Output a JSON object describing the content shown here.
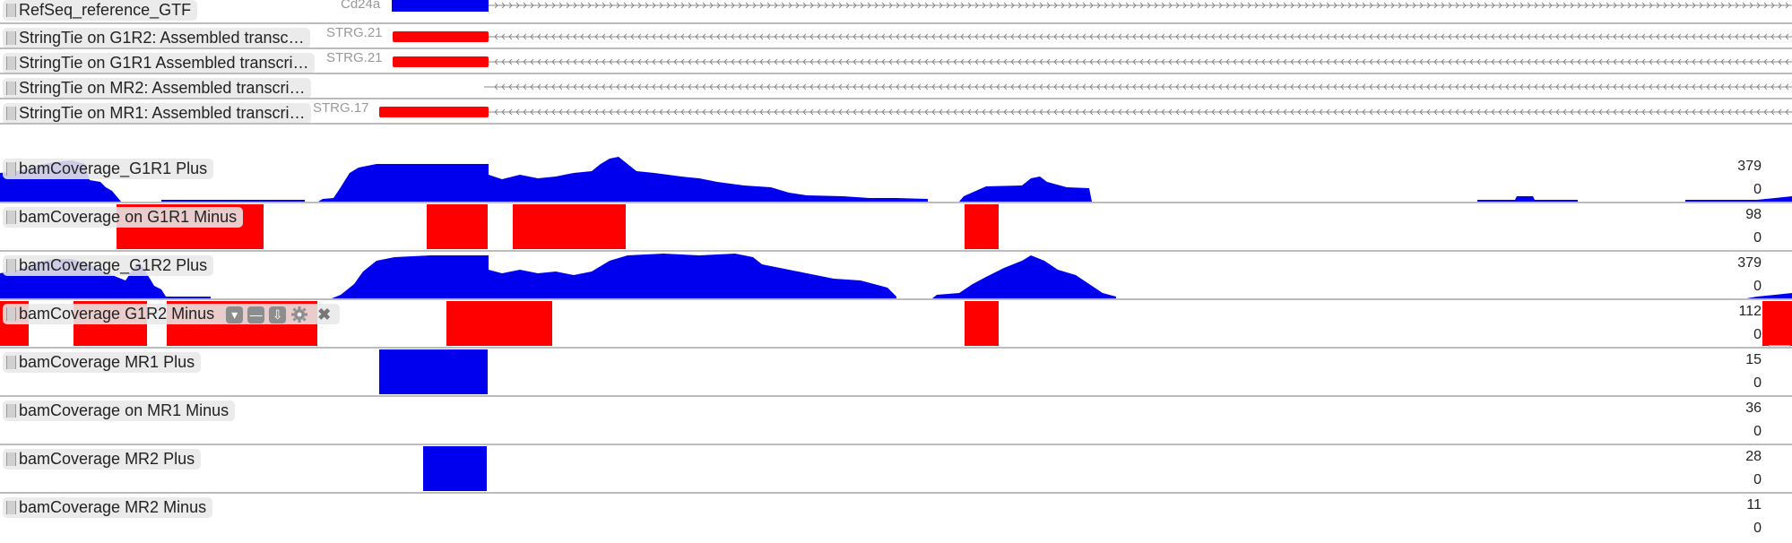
{
  "colors": {
    "plus": "#0000ee",
    "minus": "#ff0000",
    "feature_blue": "#0000ee",
    "feature_red": "#ff0000",
    "divider": "#bdbdbd"
  },
  "tracks": [
    {
      "id": "refseq",
      "label": "RefSeq_reference_GTF",
      "kind": "feature",
      "feature_name": "Cd24a",
      "feature_color": "blue",
      "strand_arrows": "right"
    },
    {
      "id": "st-g1r2",
      "label": "StringTie on G1R2: Assembled transc…",
      "kind": "feature",
      "feature_name": "STRG.21",
      "feature_color": "red",
      "strand_arrows": "left"
    },
    {
      "id": "st-g1r1",
      "label": "StringTie on G1R1 Assembled transcri…",
      "kind": "feature",
      "feature_name": "STRG.21",
      "feature_color": "red",
      "strand_arrows": "left"
    },
    {
      "id": "st-mr2",
      "label": "StringTie on MR2: Assembled transcri…",
      "kind": "feature",
      "feature_name": "",
      "feature_color": "none",
      "strand_arrows": "left"
    },
    {
      "id": "st-mr1",
      "label": "StringTie on MR1: Assembled transcri…",
      "kind": "feature",
      "feature_name": "STRG.17",
      "feature_color": "red",
      "strand_arrows": "left"
    },
    {
      "id": "g1r1-plus",
      "label": "bamCoverage_G1R1 Plus",
      "kind": "coverage",
      "color": "blue",
      "scale_max": "379",
      "scale_min": "0"
    },
    {
      "id": "g1r1-minus",
      "label": "bamCoverage on G1R1 Minus",
      "kind": "coverage",
      "color": "red",
      "scale_max": "98",
      "scale_min": "0"
    },
    {
      "id": "g1r2-plus",
      "label": "bamCoverage_G1R2 Plus",
      "kind": "coverage",
      "color": "blue",
      "scale_max": "379",
      "scale_min": "0"
    },
    {
      "id": "g1r2-minus",
      "label": "bamCoverage G1R2 Minus",
      "kind": "coverage",
      "color": "red",
      "scale_max": "112",
      "scale_min": "0",
      "hovered": true
    },
    {
      "id": "mr1-plus",
      "label": "bamCoverage MR1 Plus",
      "kind": "coverage",
      "color": "blue",
      "scale_max": "15",
      "scale_min": "0"
    },
    {
      "id": "mr1-minus",
      "label": "bamCoverage on MR1 Minus",
      "kind": "coverage",
      "color": "red",
      "scale_max": "36",
      "scale_min": "0"
    },
    {
      "id": "mr2-plus",
      "label": "bamCoverage MR2 Plus",
      "kind": "coverage",
      "color": "blue",
      "scale_max": "28",
      "scale_min": "0"
    },
    {
      "id": "mr2-minus",
      "label": "bamCoverage MR2 Minus",
      "kind": "coverage",
      "color": "red",
      "scale_max": "11",
      "scale_min": "0"
    }
  ],
  "track_menu": {
    "dropdown_icon": "chevron-down-icon",
    "minimize_icon": "minus-icon",
    "download_icon": "download-icon",
    "settings_icon": "gear-icon",
    "close_icon": "close-icon"
  }
}
